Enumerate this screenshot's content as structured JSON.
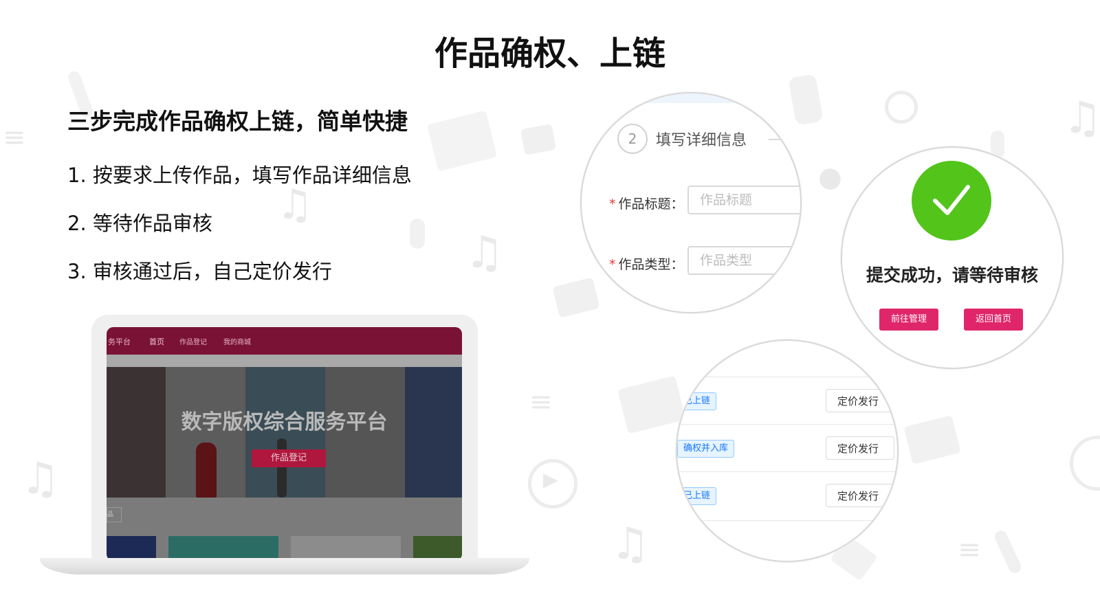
{
  "title": "作品确权、上链",
  "subtitle": "三步完成作品确权上链，简单快捷",
  "steps": [
    "1. 按要求上传作品，填写作品详细信息",
    "2. 等待作品审核",
    "3. 审核通过后，自己定价发行"
  ],
  "laptop": {
    "nav": {
      "brand": "务平台",
      "items": [
        "首页",
        "作品登记",
        "我的商城"
      ]
    },
    "banner_title": "数字版权综合服务平台",
    "banner_button": "作品登记",
    "section_label": "品"
  },
  "form_circle": {
    "step_number": "2",
    "step_title": "填写详细信息",
    "fields": [
      {
        "label": "作品标题：",
        "placeholder": "作品标题"
      },
      {
        "label": "作品类型：",
        "placeholder": "作品类型"
      }
    ]
  },
  "success_circle": {
    "message": "提交成功，请等待审核",
    "buttons": [
      "前往管理",
      "返回首页"
    ],
    "check_color": "#52c41a",
    "button_color": "#e0266a"
  },
  "list_circle": {
    "rows": [
      {
        "tag": "已上链",
        "action": "定价发行"
      },
      {
        "tag": "确权并入库",
        "action": "定价发行"
      },
      {
        "tag": "已上链",
        "action": "定价发行"
      }
    ]
  }
}
